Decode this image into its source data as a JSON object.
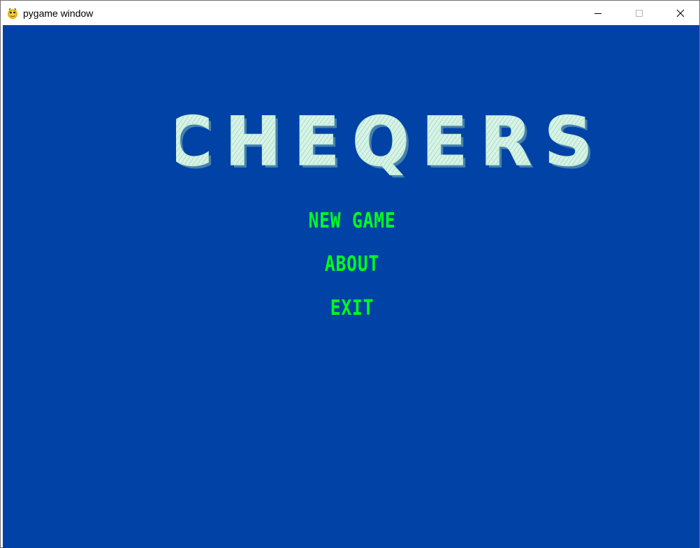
{
  "window": {
    "title": "pygame window",
    "icon": "pygame-snake-icon",
    "controls": [
      "minimize-icon",
      "maximize-icon",
      "close-icon"
    ]
  },
  "game": {
    "background_color": "#0042a6",
    "logo_text": "CHEQERS",
    "logo_color": "#c6ecd9",
    "menu_color": "#00ff1e",
    "menu": {
      "new_game": "NEW GAME",
      "about": "ABOUT",
      "exit": "EXIT"
    }
  }
}
